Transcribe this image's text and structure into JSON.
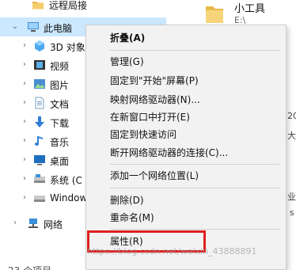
{
  "nav": {
    "items": [
      {
        "label": "远程局接",
        "icon": "folder-icon",
        "expanded": false
      },
      {
        "label": "此电脑",
        "icon": "computer-icon",
        "expanded": true
      },
      {
        "label": "3D 对象",
        "icon": "3d-objects-icon"
      },
      {
        "label": "视频",
        "icon": "video-icon"
      },
      {
        "label": "图片",
        "icon": "pictures-icon"
      },
      {
        "label": "文档",
        "icon": "documents-icon"
      },
      {
        "label": "下载",
        "icon": "download-icon"
      },
      {
        "label": "音乐",
        "icon": "music-icon"
      },
      {
        "label": "桌面",
        "icon": "desktop-icon"
      },
      {
        "label": "系统 (C",
        "icon": "drive-icon"
      },
      {
        "label": "Window",
        "icon": "drive-icon"
      },
      {
        "label": "网络",
        "icon": "network-icon"
      },
      {
        "label": "23 个项目",
        "icon": ""
      }
    ]
  },
  "content": {
    "title": "小工具",
    "sub": "E:\\",
    "frags": [
      "20",
      "大",
      "业",
      "s"
    ]
  },
  "menu": {
    "items": [
      {
        "label": "折叠(A)",
        "bold": true
      },
      {
        "label": "管理(G)"
      },
      {
        "label": "固定到\"开始\"屏幕(P)"
      },
      {
        "label": "映射网络驱动器(N)..."
      },
      {
        "label": "在新窗口中打开(E)"
      },
      {
        "label": "固定到快速访问"
      },
      {
        "label": "断开网络驱动器的连接(C)..."
      },
      {
        "label": "添加一个网络位置(L)"
      },
      {
        "label": "删除(D)"
      },
      {
        "label": "重命名(M)"
      },
      {
        "label": "属性(R)"
      }
    ]
  },
  "watermark": "https://blog.csdn.net/weixin_43888891",
  "colors": {
    "selection": "#cce8ff",
    "menu_bg": "#f2f2f2",
    "highlight": "#e02020",
    "folder": "#e8b84a"
  }
}
